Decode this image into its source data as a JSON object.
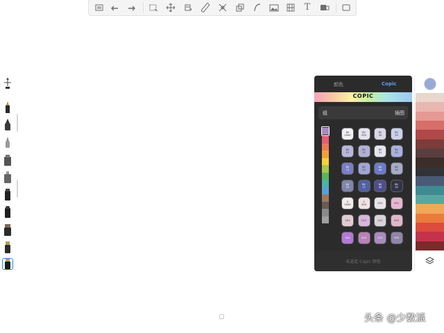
{
  "toolbar": {
    "icons": [
      "gallery-icon",
      "undo-icon",
      "redo-icon",
      "selection-icon",
      "transform-icon",
      "fill-icon",
      "ruler-icon",
      "symmetry-icon",
      "shape-icon",
      "curve-icon",
      "image-icon",
      "perspective-icon",
      "text-icon",
      "tools-icon",
      "fullscreen-icon"
    ],
    "text_tool_glyph": "T"
  },
  "brushes": {
    "items": [
      "ruler-brush",
      "pencil",
      "marker",
      "fine-pen",
      "airbrush",
      "spray-can",
      "chisel-marker",
      "round-marker",
      "wide-marker",
      "brush-pen",
      "copic-marker"
    ],
    "active_index": 10
  },
  "panel": {
    "tabs": [
      "颜色",
      "Copic"
    ],
    "active_tab": "Copic",
    "logo": "COPIC",
    "group_label": "组",
    "group_value": "插图",
    "group_strip": [
      "#a98bc2",
      "#e15e76",
      "#ec7a59",
      "#f2a03a",
      "#f6d239",
      "#a5c94b",
      "#58b45d",
      "#4fb1a7",
      "#5a9fd3",
      "#9a7a62",
      "#6b5a52",
      "#8a8a8a",
      "#a0a0a0"
    ],
    "swatches": [
      {
        "label": [
          "BV",
          "0000"
        ],
        "color": "#f3f1f7",
        "text": "#333333"
      },
      {
        "label": [
          "BV",
          "000"
        ],
        "color": "#e4e2ee",
        "text": "#333333"
      },
      {
        "label": [
          "BV",
          "00"
        ],
        "color": "#d9d8e9",
        "text": "#333333"
      },
      {
        "label": [
          "BV",
          "20"
        ],
        "color": "#cdd0ea",
        "text": "#333333"
      },
      {
        "label": [
          "BV",
          "01"
        ],
        "color": "#b9b6dc",
        "text": "#333333"
      },
      {
        "label": [
          "BV",
          "11"
        ],
        "color": "#b3b0d6",
        "text": "#333333"
      },
      {
        "label": [
          "BV",
          "31"
        ],
        "color": "#e4e5ee",
        "text": "#333333"
      },
      {
        "label": [
          "BV",
          "02"
        ],
        "color": "#a8b1de",
        "text": "#333333"
      },
      {
        "label": [
          "BV",
          "13"
        ],
        "color": "#7a7fc4",
        "text": "#ffffff"
      },
      {
        "label": [
          "BV",
          "23"
        ],
        "color": "#a1a7d2",
        "text": "#333333"
      },
      {
        "label": [
          "BV",
          "04"
        ],
        "color": "#6c7bc6",
        "text": "#ffffff"
      },
      {
        "label": [
          "BV",
          "34"
        ],
        "color": "#a6abc9",
        "text": "#333333"
      },
      {
        "label": [
          "BV",
          "25"
        ],
        "color": "#7e86ad",
        "text": "#ffffff"
      },
      {
        "label": [
          "BV",
          "17"
        ],
        "color": "#5060a2",
        "text": "#ffffff"
      },
      {
        "label": [
          "BV",
          "08"
        ],
        "color": "#4d4f8e",
        "text": "#ffffff"
      },
      {
        "label": [
          "BV",
          "29"
        ],
        "color": "#323548",
        "text": "#ffffff"
      },
      {
        "label": [
          "V",
          "0000"
        ],
        "color": "#f3eded",
        "text": "#333333"
      },
      {
        "label": [
          "V",
          "000"
        ],
        "color": "#f1e2e6",
        "text": "#333333"
      },
      {
        "label": [
          "V20"
        ],
        "color": "#e9e3ea",
        "text": "#333333"
      },
      {
        "label": [
          "V01"
        ],
        "color": "#e6b7d2",
        "text": "#333333"
      },
      {
        "label": [
          "V91"
        ],
        "color": "#e1cbd3",
        "text": "#333333"
      },
      {
        "label": [
          "V12"
        ],
        "color": "#d6b7d9",
        "text": "#333333"
      },
      {
        "label": [
          "V22"
        ],
        "color": "#d9d3dc",
        "text": "#333333"
      },
      {
        "label": [
          "V93"
        ],
        "color": "#e0b8c8",
        "text": "#333333"
      },
      {
        "label": [
          "V04"
        ],
        "color": "#b37ad4",
        "text": "#ffffff"
      },
      {
        "label": [
          "V05"
        ],
        "color": "#b982b9",
        "text": "#ffffff"
      },
      {
        "label": [
          "V15"
        ],
        "color": "#a98bbd",
        "text": "#ffffff"
      },
      {
        "label": [
          "V25"
        ],
        "color": "#8f86a9",
        "text": "#ffffff"
      }
    ],
    "footer": "未选定 Copic 颜色"
  },
  "palette": {
    "current_color": "#9aa8d8",
    "bands": [
      "#e9d7cd",
      "#e8b7b0",
      "#e49994",
      "#d76e69",
      "#ae4849",
      "#7d3b3b",
      "#5a3e40",
      "#3c2d29",
      "#323337",
      "#4a5a76",
      "#3e8b92",
      "#5aa7a2",
      "#f0a857",
      "#ec7a3c",
      "#dd4b3c",
      "#c4324b",
      "#7c2a2b"
    ]
  },
  "watermark": "头条 @少数派"
}
